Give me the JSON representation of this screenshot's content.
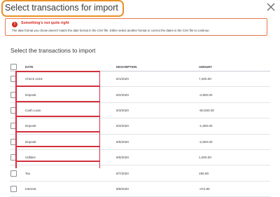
{
  "dialog": {
    "title": "Select transactions for import"
  },
  "alert": {
    "title": "Something's not quite right",
    "message": "The date format you chose doesn't match the date format in the CSV file. Either select another format or correct the dates in the CSV file to continue."
  },
  "section": {
    "subtitle": "Select the transactions to import"
  },
  "table": {
    "headers": {
      "date": "DATE",
      "description": "DESCRIPTION",
      "amount": "AMOUNT"
    },
    "rows": [
      {
        "date": "Check 1215",
        "description": "8/1/2020",
        "amount": "7,200.00"
      },
      {
        "date": "Deposit",
        "description": "8/2/2020",
        "amount": "-4,800.00"
      },
      {
        "date": "Cash Loan",
        "description": "8/3/2020",
        "amount": "-60,000.00"
      },
      {
        "date": "Deposit",
        "description": "8/4/2020",
        "amount": "-1,500.00"
      },
      {
        "date": "Deposit",
        "description": "8/5/2020",
        "amount": "-2,500.00"
      },
      {
        "date": "Utilities",
        "description": "8/6/2020",
        "amount": "1,000.00"
      },
      {
        "date": "Tax",
        "description": "8/7/2020",
        "amount": "196.80"
      },
      {
        "date": "Interest",
        "description": "8/8/2020",
        "amount": "-472.80"
      }
    ]
  },
  "colors": {
    "title_highlight": "#e8912b",
    "error": "#d52b1e",
    "alert_border": "#e8784b",
    "annotation_box": "#d3303d"
  }
}
